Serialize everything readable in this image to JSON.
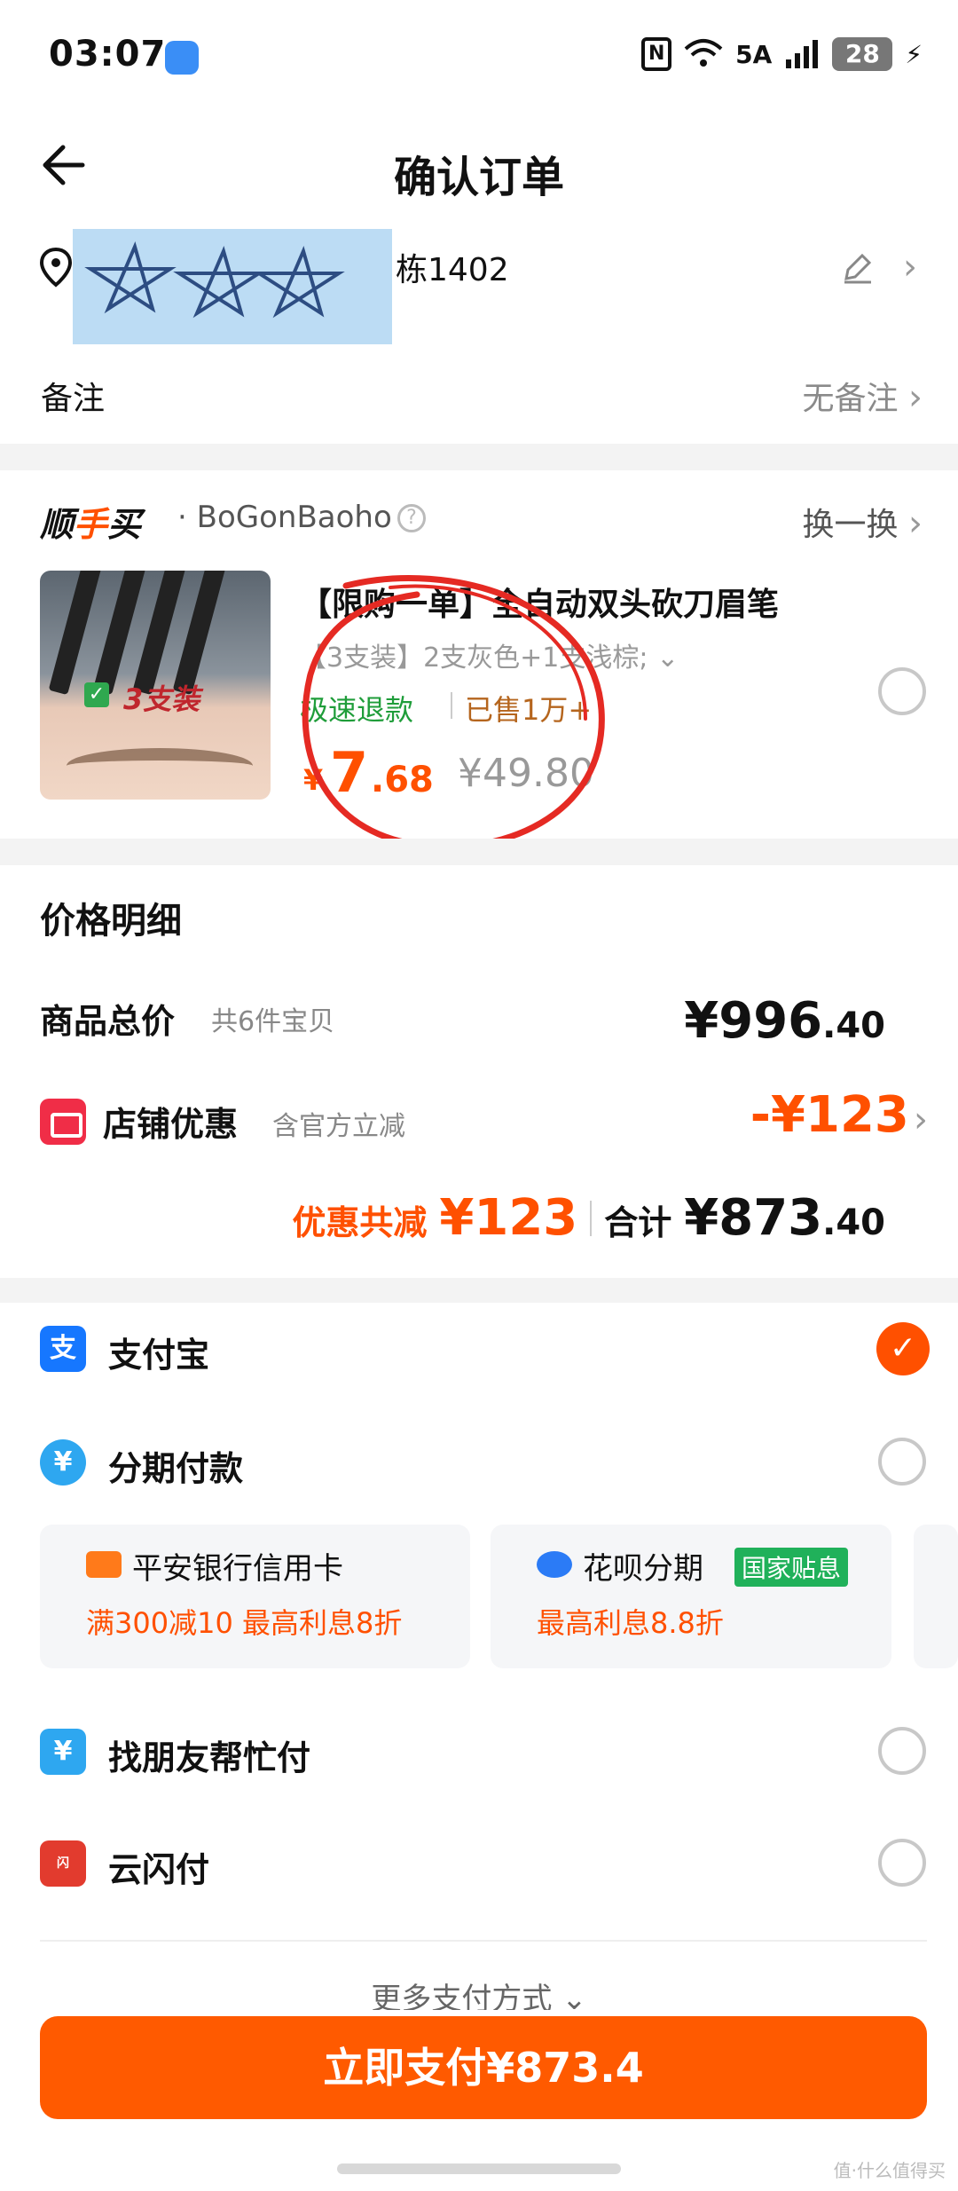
{
  "status_bar": {
    "time": "03:07",
    "network": "5A",
    "battery": "28"
  },
  "header": {
    "title": "确认订单"
  },
  "address": {
    "text": "栋1402"
  },
  "note": {
    "label": "备注",
    "value": "无备注"
  },
  "shop": {
    "logo_prefix": "顺",
    "logo_hand": "手",
    "logo_suffix": "买",
    "dot": "·",
    "name": "BoGonBaoho",
    "help": "?",
    "swap_label": "换一换"
  },
  "product": {
    "title": "【限购一单】全自动双头砍刀眉笔",
    "spec": "【3支装】2支灰色+1支浅棕;",
    "image_tag": "3支装",
    "tag_fast_refund": "极速退款",
    "tag_sold": "已售1万+",
    "price_currency": "¥",
    "price_int": "7",
    "price_dec": ".68",
    "price_original": "¥49.80"
  },
  "price_detail": {
    "title": "价格明细",
    "goods_total_label": "商品总价",
    "goods_total_sub": "共6件宝贝",
    "goods_total_int": "¥996",
    "goods_total_dec": ".40",
    "shop_discount_label": "店铺优惠",
    "shop_discount_sub": "含官方立减",
    "shop_discount_value": "-¥123",
    "saved_label": "优惠共减",
    "saved_value": "¥123",
    "total_label": "合计",
    "total_int": "¥873",
    "total_dec": ".40"
  },
  "payment": {
    "alipay": {
      "label": "支付宝",
      "icon": "支"
    },
    "installment": {
      "label": "分期付款"
    },
    "card_bank": {
      "title": "平安银行信用卡",
      "sub": "满300减10  最高利息8折"
    },
    "card_huabei": {
      "title": "花呗分期",
      "badge": "国家贴息",
      "sub": "最高利息8.8折"
    },
    "friend_pay": {
      "label": "找朋友帮忙付"
    },
    "unionpay": {
      "label": "云闪付"
    },
    "more": "更多支付方式"
  },
  "pay_button": {
    "label": "立即支付¥873.4"
  },
  "watermark": "值·什么值得买",
  "colors": {
    "accent": "#ff5000",
    "green": "#1f9d3a",
    "alipay_blue": "#1677ff"
  }
}
